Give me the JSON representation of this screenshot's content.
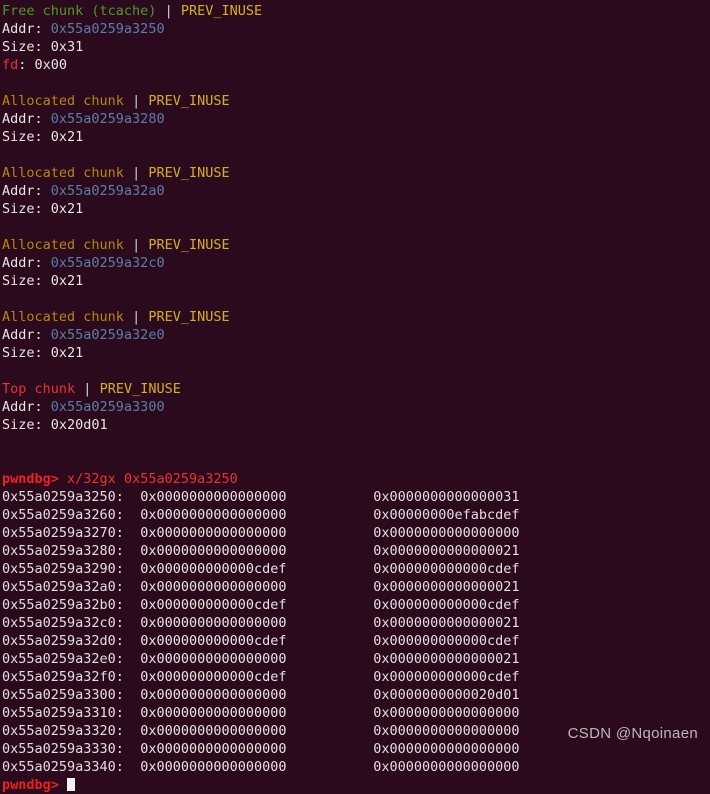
{
  "terminal": {
    "background_color": "#2b0a1e",
    "foreground_color": "#e8e4e0",
    "colors": {
      "free_chunk": "#4f9b1f",
      "allocated_chunk": "#b8860b",
      "top_chunk": "#e8342c",
      "flag": "#d4b021",
      "address": "#5a7fa8",
      "prompt": "#f02020",
      "fd_label": "#e8342c"
    }
  },
  "chunks": [
    {
      "type_label": "Free chunk (tcache)",
      "type_color_key": "free_chunk",
      "separator": "|",
      "flag": "PREV_INUSE",
      "addr_label": "Addr:",
      "addr_value": "0x55a0259a3250",
      "size_label": "Size:",
      "size_value": "0x31",
      "fd_label": "fd",
      "fd_sep": ": ",
      "fd_value": "0x00"
    },
    {
      "type_label": "Allocated chunk",
      "type_color_key": "allocated_chunk",
      "separator": "|",
      "flag": "PREV_INUSE",
      "addr_label": "Addr:",
      "addr_value": "0x55a0259a3280",
      "size_label": "Size:",
      "size_value": "0x21"
    },
    {
      "type_label": "Allocated chunk",
      "type_color_key": "allocated_chunk",
      "separator": "|",
      "flag": "PREV_INUSE",
      "addr_label": "Addr:",
      "addr_value": "0x55a0259a32a0",
      "size_label": "Size:",
      "size_value": "0x21"
    },
    {
      "type_label": "Allocated chunk",
      "type_color_key": "allocated_chunk",
      "separator": "|",
      "flag": "PREV_INUSE",
      "addr_label": "Addr:",
      "addr_value": "0x55a0259a32c0",
      "size_label": "Size:",
      "size_value": "0x21"
    },
    {
      "type_label": "Allocated chunk",
      "type_color_key": "allocated_chunk",
      "separator": "|",
      "flag": "PREV_INUSE",
      "addr_label": "Addr:",
      "addr_value": "0x55a0259a32e0",
      "size_label": "Size:",
      "size_value": "0x21"
    },
    {
      "type_label": "Top chunk",
      "type_color_key": "top_chunk",
      "separator": "|",
      "flag": "PREV_INUSE",
      "addr_label": "Addr:",
      "addr_value": "0x55a0259a3300",
      "size_label": "Size:",
      "size_value": "0x20d01"
    }
  ],
  "command": {
    "prompt": "pwndbg>",
    "text": "x/32gx 0x55a0259a3250"
  },
  "memory_dump": {
    "rows": [
      {
        "addr": "0x55a0259a3250:",
        "v1": "0x0000000000000000",
        "v2": "0x0000000000000031"
      },
      {
        "addr": "0x55a0259a3260:",
        "v1": "0x0000000000000000",
        "v2": "0x00000000efabcdef"
      },
      {
        "addr": "0x55a0259a3270:",
        "v1": "0x0000000000000000",
        "v2": "0x0000000000000000"
      },
      {
        "addr": "0x55a0259a3280:",
        "v1": "0x0000000000000000",
        "v2": "0x0000000000000021"
      },
      {
        "addr": "0x55a0259a3290:",
        "v1": "0x000000000000cdef",
        "v2": "0x000000000000cdef"
      },
      {
        "addr": "0x55a0259a32a0:",
        "v1": "0x0000000000000000",
        "v2": "0x0000000000000021"
      },
      {
        "addr": "0x55a0259a32b0:",
        "v1": "0x000000000000cdef",
        "v2": "0x000000000000cdef"
      },
      {
        "addr": "0x55a0259a32c0:",
        "v1": "0x0000000000000000",
        "v2": "0x0000000000000021"
      },
      {
        "addr": "0x55a0259a32d0:",
        "v1": "0x000000000000cdef",
        "v2": "0x000000000000cdef"
      },
      {
        "addr": "0x55a0259a32e0:",
        "v1": "0x0000000000000000",
        "v2": "0x0000000000000021"
      },
      {
        "addr": "0x55a0259a32f0:",
        "v1": "0x000000000000cdef",
        "v2": "0x000000000000cdef"
      },
      {
        "addr": "0x55a0259a3300:",
        "v1": "0x0000000000000000",
        "v2": "0x0000000000020d01"
      },
      {
        "addr": "0x55a0259a3310:",
        "v1": "0x0000000000000000",
        "v2": "0x0000000000000000"
      },
      {
        "addr": "0x55a0259a3320:",
        "v1": "0x0000000000000000",
        "v2": "0x0000000000000000"
      },
      {
        "addr": "0x55a0259a3330:",
        "v1": "0x0000000000000000",
        "v2": "0x0000000000000000"
      },
      {
        "addr": "0x55a0259a3340:",
        "v1": "0x0000000000000000",
        "v2": "0x0000000000000000"
      }
    ]
  },
  "final_prompt": {
    "prompt": "pwndbg>"
  },
  "watermark": {
    "text": "CSDN @Nqoinaen"
  }
}
